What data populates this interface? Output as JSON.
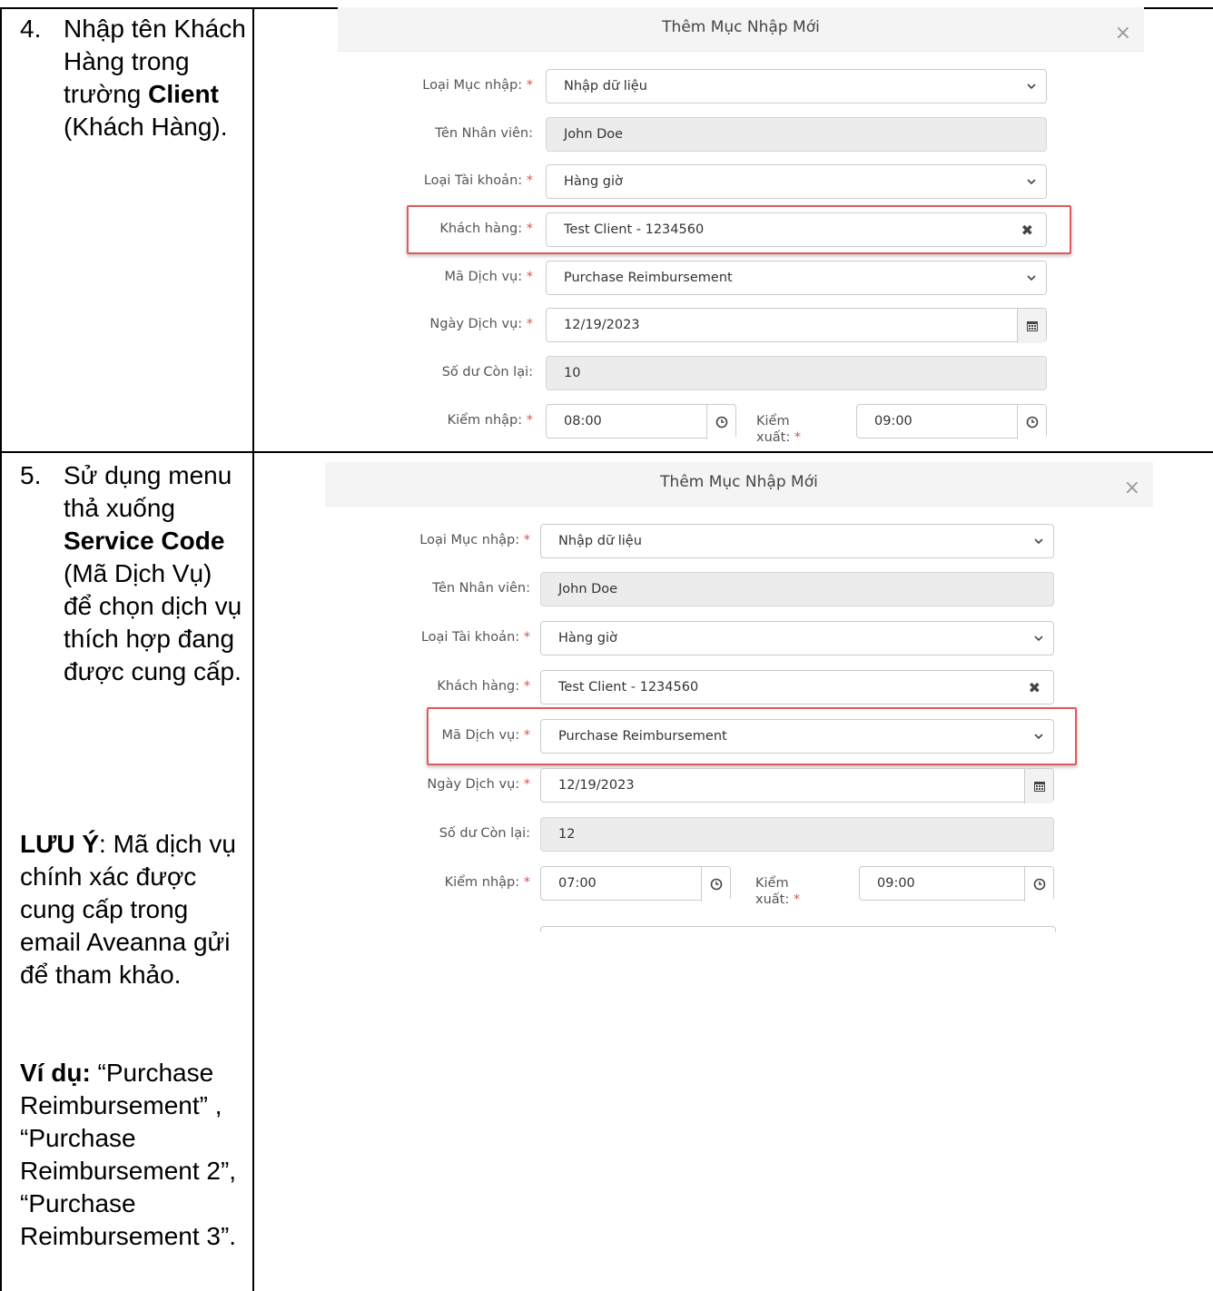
{
  "steps": [
    {
      "number": "4.",
      "text_before": "Nhập tên Khách Hàng trong trường ",
      "bold": "Client",
      "text_after": " (Khách Hàng)."
    },
    {
      "number": "5.",
      "text_before": "Sử dụng menu thả xuống ",
      "bold": "Service Code",
      "text_after": " (Mã Dịch Vụ) để chọn dịch vụ thích hợp đang được cung cấp."
    }
  ],
  "note": {
    "label": "LƯU Ý",
    "text": ": Mã dịch vụ chính xác được cung cấp trong email Aveanna gửi để tham khảo."
  },
  "example": {
    "label": "Ví dụ:",
    "text": " “Purchase Reimbursement” , “Purchase Reimbursement 2”, “Purchase Reimbursement 3”."
  },
  "modal1": {
    "title": "Thêm Mục Nhập Mới",
    "close": "×",
    "entry_type_label": "Loại Mục nhập:",
    "entry_type_value": "Nhập dữ liệu",
    "employee_label": "Tên Nhân viên:",
    "employee_value": "John Doe",
    "account_type_label": "Loại Tài khoản:",
    "account_type_value": "Hàng giờ",
    "client_label": "Khách hàng:",
    "client_value": "Test Client - 1234560",
    "service_code_label": "Mã Dịch vụ:",
    "service_code_value": "Purchase Reimbursement",
    "service_date_label": "Ngày Dịch vụ:",
    "service_date_value": "12/19/2023",
    "balance_label": "Số dư Còn lại:",
    "balance_value": "10",
    "check_in_label": "Kiểm nhập:",
    "check_in_value": "08:00",
    "check_out_label_1": "Kiểm",
    "check_out_label_2": "xuất:",
    "check_out_value": "09:00",
    "required_mark": "*",
    "clear_mark": "✖"
  },
  "modal2": {
    "title": "Thêm Mục Nhập Mới",
    "close": "×",
    "entry_type_label": "Loại Mục nhập:",
    "entry_type_value": "Nhập dữ liệu",
    "employee_label": "Tên Nhân viên:",
    "employee_value": "John Doe",
    "account_type_label": "Loại Tài khoản:",
    "account_type_value": "Hàng giờ",
    "client_label": "Khách hàng:",
    "client_value": "Test Client - 1234560",
    "service_code_label": "Mã Dịch vụ:",
    "service_code_value": "Purchase Reimbursement",
    "service_date_label": "Ngày Dịch vụ:",
    "service_date_value": "12/19/2023",
    "balance_label": "Số dư Còn lại:",
    "balance_value": "12",
    "check_in_label": "Kiểm nhập:",
    "check_in_value": "07:00",
    "check_out_label_1": "Kiểm",
    "check_out_label_2": "xuất:",
    "check_out_value": "09:00",
    "required_mark": "*",
    "clear_mark": "✖"
  },
  "colors": {
    "highlight": "#e0595d",
    "required": "#d9534f"
  }
}
